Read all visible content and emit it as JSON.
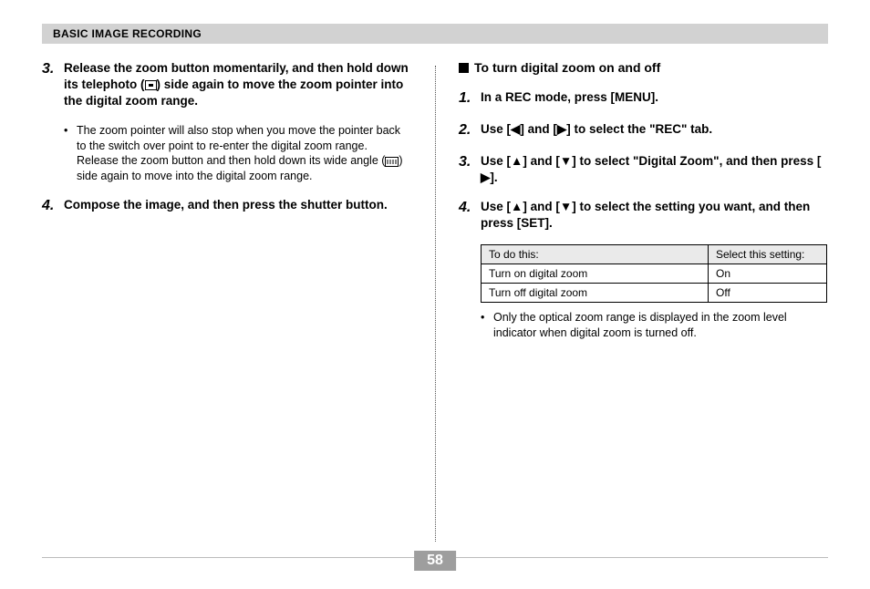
{
  "header": {
    "title": "BASIC IMAGE RECORDING"
  },
  "left": {
    "step3": {
      "num": "3.",
      "text_a": "Release the zoom button momentarily, and then hold down its telephoto (",
      "text_b": ") side again to move the zoom pointer into the digital zoom range."
    },
    "bullet1_a": "The zoom pointer will also stop when you move the pointer back to the switch over point to re-enter the digital zoom range. Release the zoom button and then hold down its wide angle (",
    "bullet1_b": ") side again to move into the digital zoom range.",
    "step4": {
      "num": "4.",
      "text": "Compose the image, and then press the shutter button."
    }
  },
  "right": {
    "section_title": "To turn digital zoom on and off",
    "step1": {
      "num": "1.",
      "text": "In a REC mode, press [MENU]."
    },
    "step2": {
      "num": "2.",
      "text_a": "Use [",
      "text_b": "] and [",
      "text_c": "] to select the \"REC\" tab."
    },
    "step3": {
      "num": "3.",
      "text_a": "Use [",
      "text_b": "] and [",
      "text_c": "] to select \"Digital Zoom\", and then press [",
      "text_d": "]."
    },
    "step4": {
      "num": "4.",
      "text_a": "Use [",
      "text_b": "] and [",
      "text_c": "] to select the setting you want, and then press [SET]."
    },
    "table": {
      "h1": "To do this:",
      "h2": "Select this setting:",
      "r1c1": "Turn on digital zoom",
      "r1c2": "On",
      "r2c1": "Turn off digital zoom",
      "r2c2": "Off"
    },
    "bullet": "Only the optical zoom range is displayed in the zoom level indicator when digital zoom is turned off."
  },
  "page_number": "58",
  "glyphs": {
    "left": "◀",
    "right": "▶",
    "up": "▲",
    "down": "▼",
    "bullet": "•"
  }
}
